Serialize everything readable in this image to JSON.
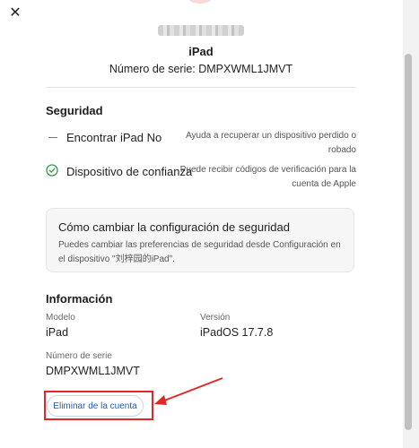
{
  "modal": {
    "close_glyph": "✕",
    "device_name": "iPad",
    "serial_header": "Número de serie: DMPXWML1JMVT"
  },
  "security": {
    "title": "Seguridad",
    "items": [
      {
        "label": "Encontrar iPad No",
        "description": "Ayuda a recuperar un dispositivo perdido o robado",
        "icon": "dash-icon"
      },
      {
        "label": "Dispositivo de confianza",
        "description": "Puede recibir códigos de verificación para la cuenta de Apple",
        "icon": "check-circle-icon"
      }
    ],
    "box_title": "Cómo cambiar la configuración de seguridad",
    "box_text": "Puedes cambiar las preferencias de seguridad desde Configuración en el dispositivo \"刘梓园的iPad\"."
  },
  "info": {
    "title": "Información",
    "model_label": "Modelo",
    "model_value": "iPad",
    "version_label": "Versión",
    "version_value": "iPadOS 17.7.8",
    "serial_label": "Número de serie",
    "serial_value": "DMPXWML1JMVT"
  },
  "actions": {
    "delete_account": "Eliminar de la cuenta"
  },
  "colors": {
    "accent": "#1a5dbf",
    "check_green": "#2e9c4a",
    "annotation_red": "#e32626"
  }
}
